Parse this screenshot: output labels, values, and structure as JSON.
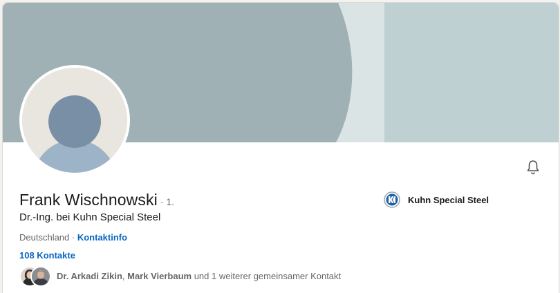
{
  "profile": {
    "name": "Frank Wischnowski",
    "degree": "· 1.",
    "headline": "Dr.-Ing. bei Kuhn Special Steel",
    "location": "Deutschland",
    "separator": " · ",
    "contact_info_link": "Kontaktinfo",
    "connections": "108 Kontakte"
  },
  "mutual": {
    "name1": "Dr. Arkadi Zikin",
    "separator": ", ",
    "name2": "Mark Vierbaum",
    "rest": " und 1 weiterer gemeinsamer Kontakt"
  },
  "company": {
    "name": "Kuhn Special Steel",
    "logo_icon": "kuhn-logo-icon"
  },
  "icons": {
    "bell": "bell-icon",
    "avatar": "default-avatar-icon"
  },
  "colors": {
    "cover_dark": "#a0b1b5",
    "cover_light": "#dbe4e5",
    "cover_right": "#bfd0d3",
    "link": "#0a66c2",
    "text_secondary": "#666666"
  }
}
